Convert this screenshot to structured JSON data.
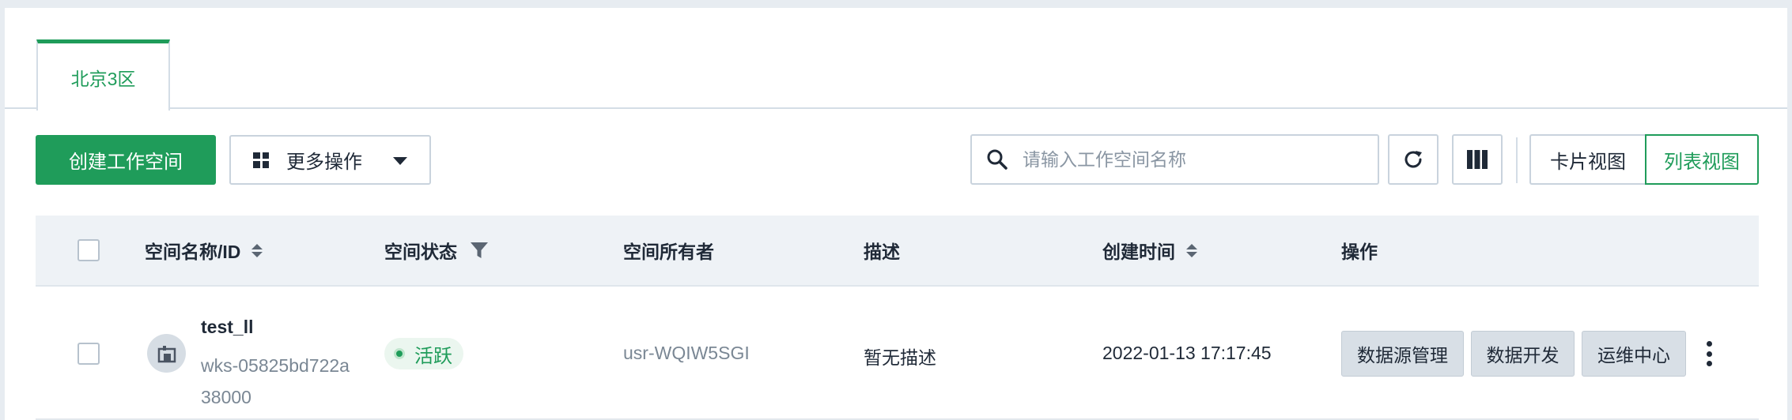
{
  "tabs": [
    {
      "label": "北京3区",
      "active": true
    }
  ],
  "toolbar": {
    "create_label": "创建工作空间",
    "more_label": "更多操作",
    "search_placeholder": "请输入工作空间名称",
    "card_view_label": "卡片视图",
    "list_view_label": "列表视图",
    "active_view": "list"
  },
  "table": {
    "columns": [
      "空间名称/ID",
      "空间状态",
      "空间所有者",
      "描述",
      "创建时间",
      "操作"
    ],
    "rows": [
      {
        "name": "test_ll",
        "id": "wks-05825bd722a38000",
        "status": "活跃",
        "owner": "usr-WQIW5SGI",
        "description": "暂无描述",
        "created": "2022-01-13 17:17:45",
        "actions": [
          "数据源管理",
          "数据开发",
          "运维中心"
        ]
      }
    ]
  },
  "colors": {
    "accent": "#1f9c5a",
    "header_bg": "#eef2f6",
    "status_bg": "#ebf6ef"
  }
}
